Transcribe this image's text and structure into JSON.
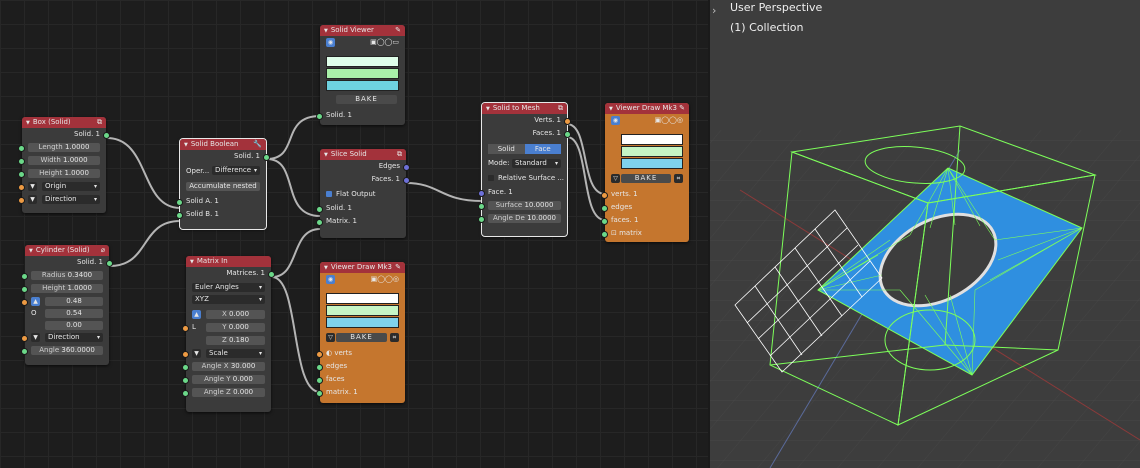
{
  "nodes": {
    "box": {
      "title": "Box (Solid)",
      "out": "Solid. 1",
      "length": {
        "label": "Length",
        "value": "1.0000"
      },
      "width": {
        "label": "Width",
        "value": "1.0000"
      },
      "height": {
        "label": "Height",
        "value": "1.0000"
      },
      "origin": "Origin",
      "direction": "Direction"
    },
    "cylinder": {
      "title": "Cylinder (Solid)",
      "out": "Solid. 1",
      "radius": {
        "label": "Radius",
        "value": "0.3400"
      },
      "height": {
        "label": "Height",
        "value": "1.0000"
      },
      "v1": "0.48",
      "v2_label": "O",
      "v2": "0.54",
      "v3": "0.00",
      "direction": "Direction",
      "angle": {
        "label": "Angle",
        "value": "360.0000"
      }
    },
    "boolean": {
      "title": "Solid Boolean",
      "out": "Solid. 1",
      "oper_label": "Oper...",
      "oper_value": "Difference",
      "accumulate": "Accumulate nested",
      "in_a": "Solid A. 1",
      "in_b": "Solid B. 1"
    },
    "viewer": {
      "title": "Solid Viewer",
      "bake": "BAKE",
      "in": "Solid. 1"
    },
    "slice": {
      "title": "Slice Solid",
      "edges": "Edges",
      "faces": "Faces. 1",
      "flat": "Flat Output",
      "in_solid": "Solid. 1",
      "in_matrix": "Matrix. 1"
    },
    "matrix": {
      "title": "Matrix In",
      "out": "Matrices. 1",
      "euler": "Euler Angles",
      "order": "XYZ",
      "l_label": "L",
      "x": {
        "label": "X",
        "value": "0.000"
      },
      "y": {
        "label": "Y",
        "value": "0.000"
      },
      "z": {
        "label": "Z",
        "value": "0.180"
      },
      "scale": "Scale",
      "angle_x": {
        "label": "Angle X",
        "value": "30.000"
      },
      "angle_y": {
        "label": "Angle Y",
        "value": "0.000"
      },
      "angle_z": {
        "label": "Angle Z",
        "value": "0.000"
      }
    },
    "viewer_draw_1": {
      "title": "Viewer Draw Mk3",
      "bake": "BAKE",
      "verts": "verts",
      "edges": "edges",
      "faces": "faces",
      "matrix": "matrix. 1"
    },
    "to_mesh": {
      "title": "Solid to Mesh",
      "verts": "Verts. 1",
      "faces": "Faces. 1",
      "mode_a": "Solid",
      "mode_b": "Face",
      "mode_label": "Mode:",
      "mode_value": "Standard",
      "relative": "Relative Surface ...",
      "in_face": "Face. 1",
      "surface": {
        "label": "Surface",
        "value": "10.0000"
      },
      "angle": {
        "label": "Angle De",
        "value": "10.0000"
      }
    },
    "viewer_draw_2": {
      "title": "Viewer Draw Mk3",
      "bake": "BAKE",
      "verts": "verts. 1",
      "edges": "edges",
      "faces": "faces. 1",
      "matrix": "matrix"
    }
  },
  "viewport": {
    "title": "User Perspective",
    "collection": "(1) Collection",
    "expand_icon": "chevron-right-icon"
  },
  "colors": {
    "header_red": "#a3323b",
    "node_orange": "#c5762e",
    "socket_green": "#6bd889",
    "socket_orange": "#ed9a43",
    "socket_purple": "#6d70d8",
    "mesh_blue": "#2f8fe0",
    "wire_green": "#7dff5a"
  }
}
